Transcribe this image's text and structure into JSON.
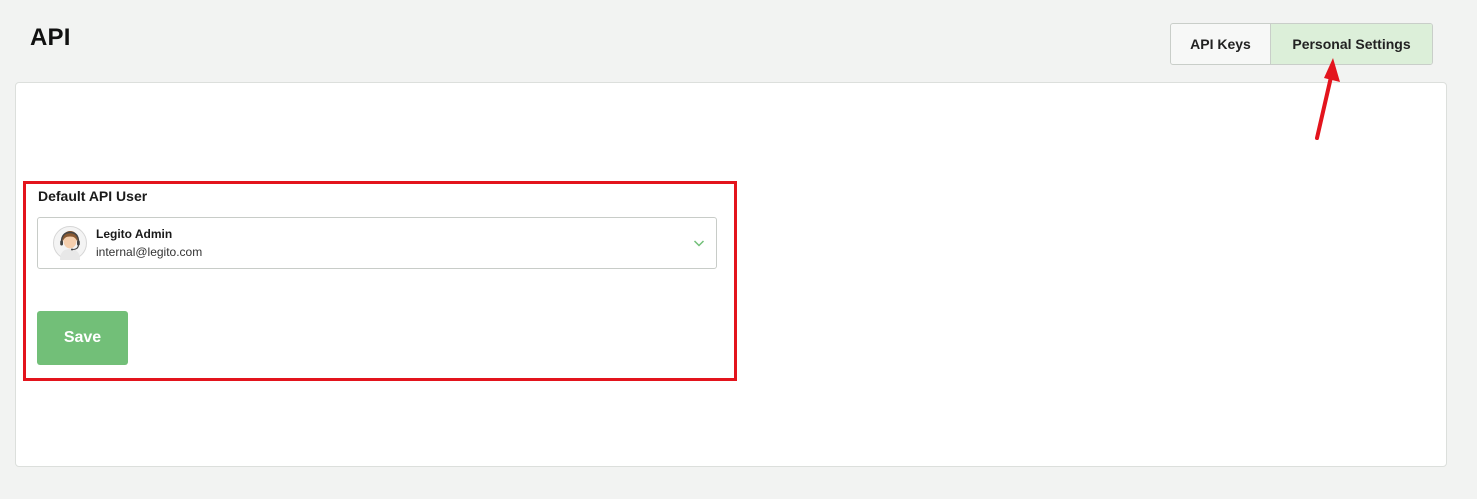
{
  "page": {
    "title": "API"
  },
  "tabs": [
    {
      "label": "API Keys",
      "active": false
    },
    {
      "label": "Personal Settings",
      "active": true
    }
  ],
  "form": {
    "field_label": "Default API User",
    "selected_user": {
      "name": "Legito Admin",
      "email": "internal@legito.com",
      "avatar_icon": "user-avatar-headset-icon"
    },
    "dropdown_icon": "chevron-down-icon",
    "save_label": "Save"
  },
  "annotations": {
    "highlight_color": "#e3141d",
    "arrow_color": "#e3141d"
  },
  "colors": {
    "accent_green": "#72bf78",
    "active_tab_bg": "#dcefd9"
  }
}
